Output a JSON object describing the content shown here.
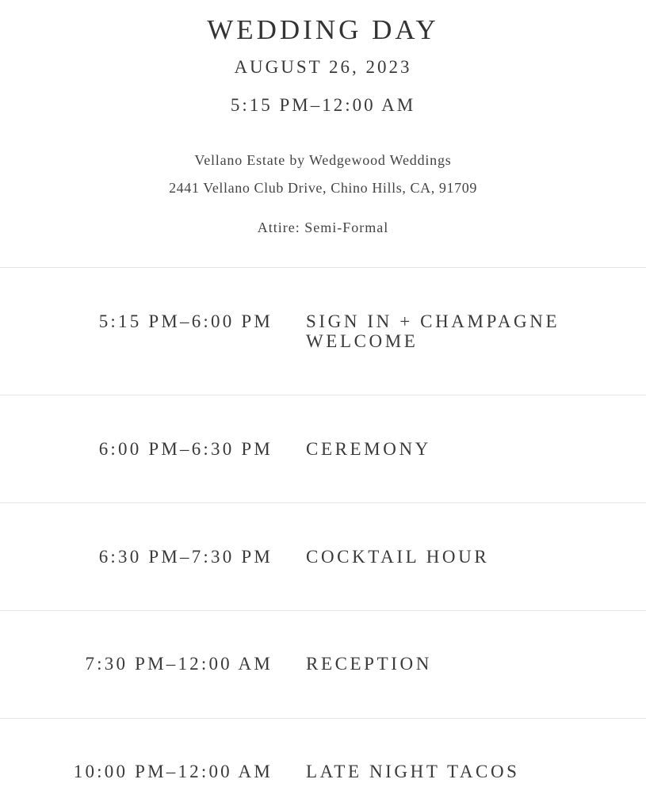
{
  "header": {
    "title": "WEDDING DAY",
    "date": "AUGUST 26, 2023",
    "time_range": "5:15 PM–12:00 AM",
    "venue": "Vellano Estate by Wedgewood Weddings",
    "address": "2441 Vellano Club Drive, Chino Hills, CA, 91709",
    "attire": "Attire: Semi-Formal"
  },
  "schedule": [
    {
      "time": "5:15 PM–6:00 PM",
      "name": "SIGN IN + CHAMPAGNE WELCOME"
    },
    {
      "time": "6:00 PM–6:30 PM",
      "name": "CEREMONY"
    },
    {
      "time": "6:30 PM–7:30 PM",
      "name": "COCKTAIL HOUR"
    },
    {
      "time": "7:30 PM–12:00 AM",
      "name": "RECEPTION"
    },
    {
      "time": "10:00 PM–12:00 AM",
      "name": "LATE NIGHT TACOS"
    }
  ]
}
